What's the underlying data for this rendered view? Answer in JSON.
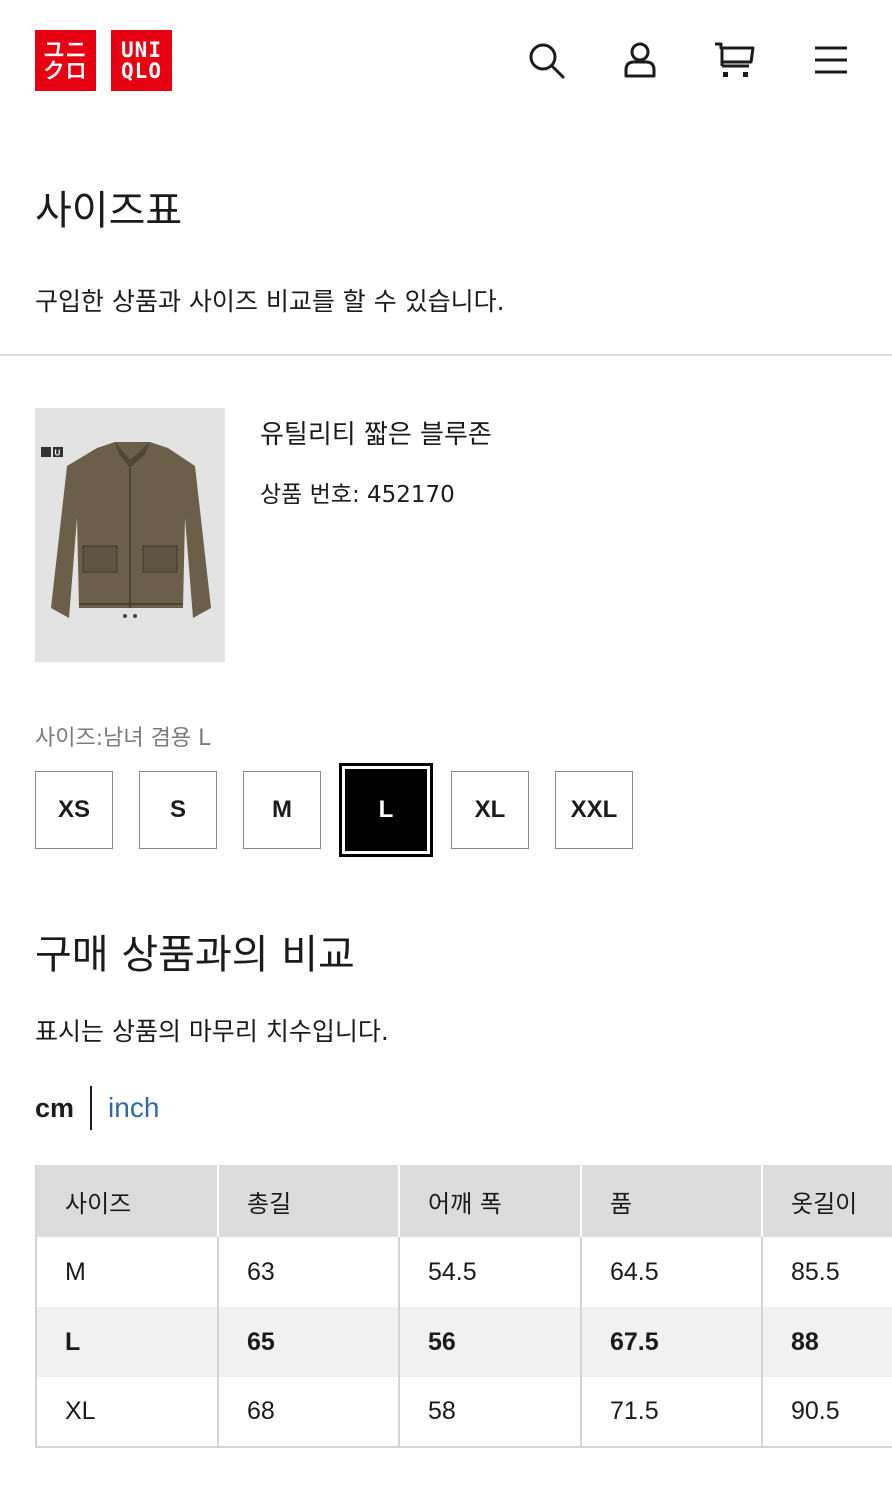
{
  "header": {
    "logo_kr_top": "ユニ",
    "logo_kr_bottom": "クロ",
    "logo_en_top": "UNI",
    "logo_en_bottom": "QLO",
    "brand_color": "#e60012",
    "icons": [
      "search-icon",
      "account-icon",
      "cart-icon",
      "menu-icon"
    ]
  },
  "page": {
    "title": "사이즈표",
    "description": "구입한 상품과 사이즈 비교를 할 수 있습니다."
  },
  "product": {
    "name": "유틸리티 짧은 블루존",
    "number_label": "상품 번호:",
    "number": "452170",
    "badge_left": "UNI",
    "badge_right": "U",
    "jacket_color": "#6b5f4a"
  },
  "size_selector": {
    "label": "사이즈:남녀 겸용 L",
    "options": [
      "XS",
      "S",
      "M",
      "L",
      "XL",
      "XXL"
    ],
    "selected": "L"
  },
  "compare": {
    "title": "구매 상품과의 비교",
    "description": "표시는 상품의 마무리 치수입니다.",
    "unit_cm": "cm",
    "unit_inch": "inch",
    "link_color": "#2f6aa5"
  },
  "table": {
    "headers": [
      "사이즈",
      "총길",
      "어깨 폭",
      "품",
      "옷길이"
    ],
    "rows": [
      [
        "M",
        "63",
        "54.5",
        "64.5",
        "85.5"
      ],
      [
        "L",
        "65",
        "56",
        "67.5",
        "88"
      ],
      [
        "XL",
        "68",
        "58",
        "71.5",
        "90.5"
      ]
    ]
  }
}
